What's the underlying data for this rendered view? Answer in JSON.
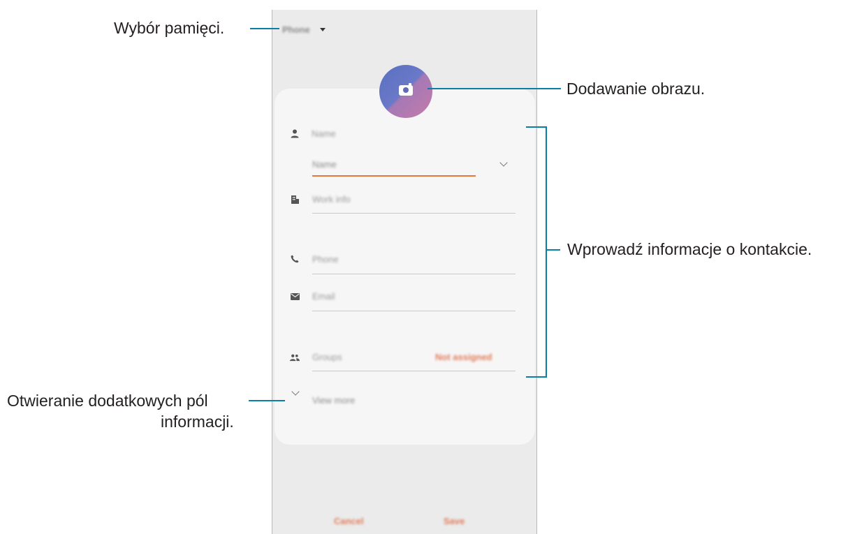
{
  "screen": {
    "storage": {
      "label": "Phone"
    },
    "fields": {
      "name_header": "Name",
      "name_input_placeholder": "Name",
      "work_info": "Work info",
      "phone": "Phone",
      "email": "Email",
      "groups": "Groups",
      "groups_value": "Not assigned",
      "view_more": "View more"
    },
    "buttons": {
      "cancel": "Cancel",
      "save": "Save"
    }
  },
  "annotations": {
    "storage_select": "Wybór pamięci.",
    "add_image": "Dodawanie obrazu.",
    "contact_info": "Wprowadź informacje o kontakcie.",
    "more_fields_line1": "Otwieranie dodatkowych pól",
    "more_fields_line2": "informacji."
  },
  "colors": {
    "accent": "#e8753c",
    "callout_line": "#0c7ea3",
    "avatar_gradient": [
      "#5a6fbf",
      "#c57aa8"
    ]
  }
}
